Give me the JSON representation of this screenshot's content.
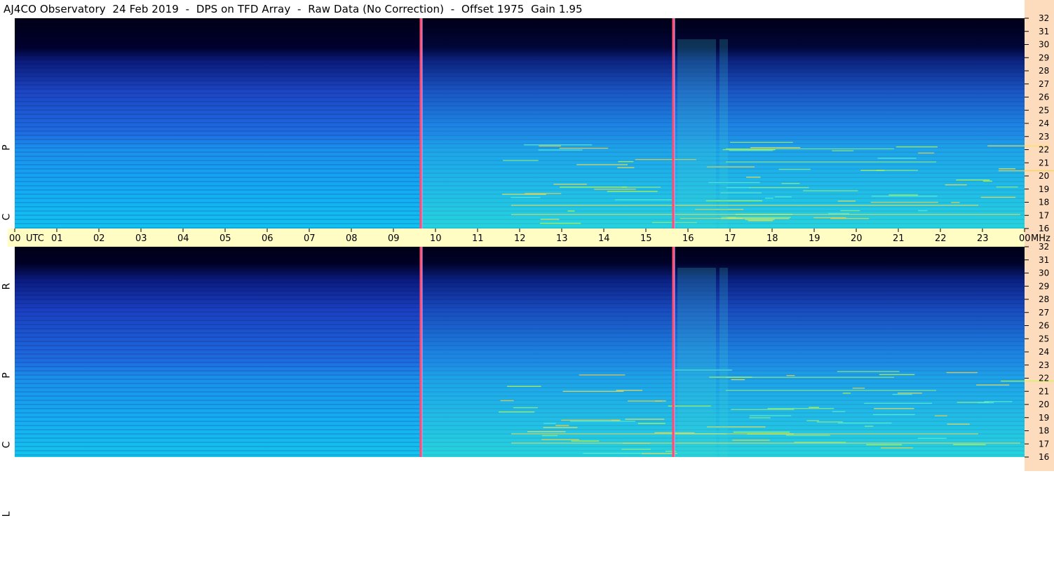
{
  "title": "AJ4CO Observatory  24 Feb 2019  -  DPS on TFD Array  -  Raw Data (No Correction)  -  Offset 1975  Gain 1.95",
  "panels": [
    {
      "id": "rcp",
      "label": [
        "R",
        "C",
        "P"
      ]
    },
    {
      "id": "lcp",
      "label": [
        "L",
        "C",
        "P"
      ]
    }
  ],
  "time_axis": {
    "ticks": [
      "00",
      "01",
      "02",
      "03",
      "04",
      "05",
      "06",
      "07",
      "08",
      "09",
      "10",
      "11",
      "12",
      "13",
      "14",
      "15",
      "16",
      "17",
      "18",
      "19",
      "20",
      "21",
      "22",
      "23",
      "00"
    ],
    "first_unit": "UTC",
    "last_unit": "MHz"
  },
  "freq_axis": {
    "ticks": [
      "32",
      "31",
      "30",
      "29",
      "28",
      "27",
      "26",
      "25",
      "24",
      "23",
      "22",
      "21",
      "20",
      "19",
      "18",
      "17",
      "16"
    ],
    "min": 16,
    "max": 32,
    "unit": "MHz"
  },
  "colors": {
    "axis_band": "#fffcc4",
    "right_axis": "#fcdcbc",
    "marker_line": "#ff4d6d",
    "background_dark": "#00001a"
  },
  "chart_data": {
    "type": "heatmap",
    "title": "AJ4CO Observatory  24 Feb 2019  -  DPS on TFD Array  -  Raw Data (No Correction)  -  Offset 1975  Gain 1.95",
    "xlabel": "UTC",
    "ylabel": "MHz",
    "xlim": [
      0,
      24
    ],
    "ylim": [
      16,
      32
    ],
    "series": [
      {
        "name": "RCP"
      },
      {
        "name": "LCP"
      }
    ],
    "markers_utc": [
      9.65,
      15.65
    ]
  }
}
